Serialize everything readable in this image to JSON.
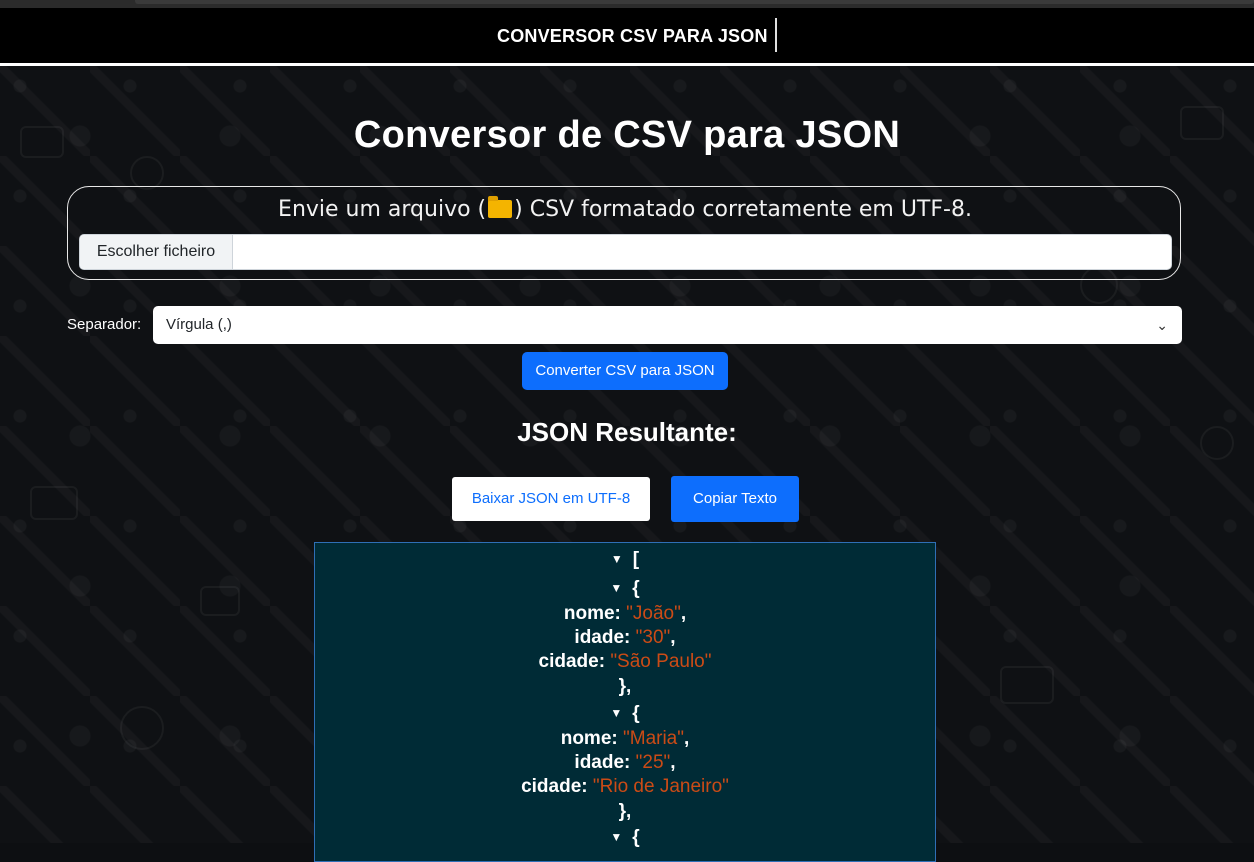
{
  "navbar": {
    "title": "CONVERSOR CSV PARA JSON"
  },
  "page": {
    "title": "Conversor de CSV para JSON"
  },
  "upload": {
    "text_before": "Envie um arquivo (",
    "text_after": ") CSV formatado corretamente em UTF-8.",
    "file_button": "Escolher ficheiro",
    "file_value": ""
  },
  "separator": {
    "label": "Separador:",
    "selected": "Vírgula (,)"
  },
  "convert_button": "Converter CSV para JSON",
  "result": {
    "title": "JSON Resultante:",
    "download_button": "Baixar JSON em UTF-8",
    "copy_button": "Copiar Texto"
  },
  "json_view": {
    "open_array": "[",
    "records": [
      {
        "nome": "\"João\"",
        "idade": "\"30\"",
        "cidade": "\"São Paulo\""
      },
      {
        "nome": "\"Maria\"",
        "idade": "\"25\"",
        "cidade": "\"Rio de Janeiro\""
      }
    ],
    "open_obj": "{",
    "close_obj": "},",
    "keys": {
      "nome": "nome:",
      "idade": "idade:",
      "cidade": "cidade:"
    },
    "comma": ","
  },
  "colors": {
    "primary": "#0d6efd",
    "json_bg": "#002b36",
    "json_string": "#cb4b16"
  }
}
